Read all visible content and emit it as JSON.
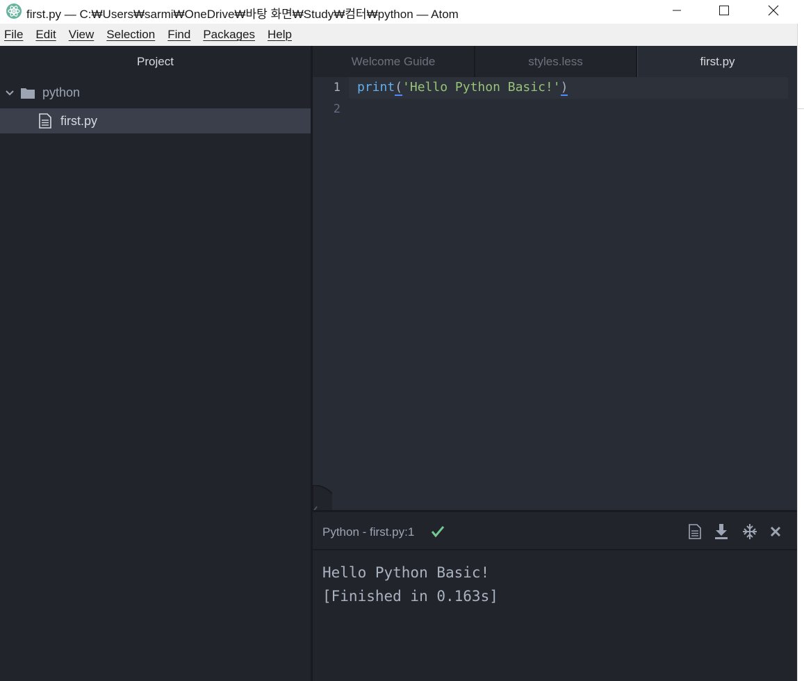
{
  "window": {
    "title": "first.py — C:₩Users₩sarmi₩OneDrive₩바탕 화면₩Study₩컴터₩python — Atom"
  },
  "menu": [
    {
      "key": "F",
      "rest": "ile"
    },
    {
      "key": "E",
      "rest": "dit"
    },
    {
      "key": "V",
      "rest": "iew"
    },
    {
      "key": "S",
      "rest": "election"
    },
    {
      "key": "F",
      "rest": "ind"
    },
    {
      "key": "P",
      "rest": "ackages"
    },
    {
      "key": "H",
      "rest": "elp"
    }
  ],
  "sidebar": {
    "title": "Project",
    "folder": {
      "name": "python",
      "icon": "folder-icon",
      "expanded": true
    },
    "file": {
      "name": "first.py",
      "icon": "file-text-icon",
      "selected": true
    }
  },
  "tabs": [
    {
      "label": "Welcome Guide",
      "active": false
    },
    {
      "label": "styles.less",
      "active": false
    },
    {
      "label": "first.py",
      "active": true
    }
  ],
  "editor": {
    "line_numbers": [
      "1",
      "2"
    ],
    "code": {
      "fn": "print",
      "open_paren": "(",
      "string": "'Hello Python Basic!'",
      "close_paren": ")"
    }
  },
  "output_panel": {
    "title": "Python - first.py:1",
    "status": "success",
    "lines": [
      "Hello Python Basic!",
      "[Finished in 0.163s]"
    ],
    "buttons": [
      "file-icon",
      "download-icon",
      "pin-icon",
      "close-icon"
    ]
  },
  "colors": {
    "sidebar_bg": "#21252b",
    "editor_bg": "#282c34",
    "string": "#98c379",
    "function": "#61afef",
    "success": "#73c990"
  }
}
